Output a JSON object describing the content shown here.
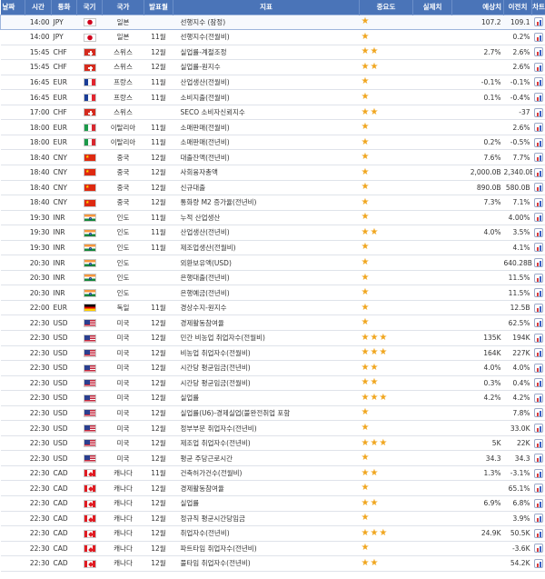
{
  "header": {
    "day": "날짜",
    "time": "시간",
    "currency": "통화",
    "flag": "국기",
    "country": "국가",
    "period": "발표월",
    "indicator": "지표",
    "importance": "중요도",
    "actual": "실제치",
    "forecast": "예상치",
    "previous": "이전치",
    "chart": "차트"
  },
  "rows": [
    {
      "time": "14:00",
      "currency": "JPY",
      "flag": "jp",
      "country": "일본",
      "period": "",
      "indicator": "선행지수 (잠정)",
      "stars": "★",
      "actual": "",
      "forecast": "107.2",
      "previous": "109.1"
    },
    {
      "time": "14:00",
      "currency": "JPY",
      "flag": "jp",
      "country": "일본",
      "period": "11월",
      "indicator": "선행지수(전월비)",
      "stars": "★",
      "actual": "",
      "forecast": "",
      "previous": "0.2%"
    },
    {
      "time": "15:45",
      "currency": "CHF",
      "flag": "ch",
      "country": "스위스",
      "period": "12월",
      "indicator": "실업률-계절조정",
      "stars": "★★",
      "actual": "",
      "forecast": "2.7%",
      "previous": "2.6%"
    },
    {
      "time": "15:45",
      "currency": "CHF",
      "flag": "ch",
      "country": "스위스",
      "period": "12월",
      "indicator": "실업률-원지수",
      "stars": "★★",
      "actual": "",
      "forecast": "",
      "previous": "2.6%"
    },
    {
      "time": "16:45",
      "currency": "EUR",
      "flag": "fr",
      "country": "프랑스",
      "period": "11월",
      "indicator": "산업생산(전월비)",
      "stars": "★",
      "actual": "",
      "forecast": "-0.1%",
      "previous": "-0.1%"
    },
    {
      "time": "16:45",
      "currency": "EUR",
      "flag": "fr",
      "country": "프랑스",
      "period": "11월",
      "indicator": "소비지출(전월비)",
      "stars": "★",
      "actual": "",
      "forecast": "0.1%",
      "previous": "-0.4%"
    },
    {
      "time": "17:00",
      "currency": "CHF",
      "flag": "ch",
      "country": "스위스",
      "period": "",
      "indicator": "SECO 소비자신뢰지수",
      "stars": "★★",
      "actual": "",
      "forecast": "",
      "previous": "-37"
    },
    {
      "time": "18:00",
      "currency": "EUR",
      "flag": "it",
      "country": "이탈리아",
      "period": "11월",
      "indicator": "소매판매(전월비)",
      "stars": "★",
      "actual": "",
      "forecast": "",
      "previous": "2.6%"
    },
    {
      "time": "18:00",
      "currency": "EUR",
      "flag": "it",
      "country": "이탈리아",
      "period": "11월",
      "indicator": "소매판매(전년비)",
      "stars": "★",
      "actual": "",
      "forecast": "0.2%",
      "previous": "-0.5%"
    },
    {
      "time": "18:40",
      "currency": "CNY",
      "flag": "cn",
      "country": "중국",
      "period": "12월",
      "indicator": "대출잔액(전년비)",
      "stars": "★",
      "actual": "",
      "forecast": "7.6%",
      "previous": "7.7%"
    },
    {
      "time": "18:40",
      "currency": "CNY",
      "flag": "cn",
      "country": "중국",
      "period": "12월",
      "indicator": "사회융자총액",
      "stars": "★",
      "actual": "",
      "forecast": "2,000.0B",
      "previous": "2,340.0B"
    },
    {
      "time": "18:40",
      "currency": "CNY",
      "flag": "cn",
      "country": "중국",
      "period": "12월",
      "indicator": "신규대출",
      "stars": "★",
      "actual": "",
      "forecast": "890.0B",
      "previous": "580.0B"
    },
    {
      "time": "18:40",
      "currency": "CNY",
      "flag": "cn",
      "country": "중국",
      "period": "12월",
      "indicator": "통화량 M2 증가율(전년비)",
      "stars": "★",
      "actual": "",
      "forecast": "7.3%",
      "previous": "7.1%"
    },
    {
      "time": "19:30",
      "currency": "INR",
      "flag": "in",
      "country": "인도",
      "period": "11월",
      "indicator": "누적 산업생산",
      "stars": "★",
      "actual": "",
      "forecast": "",
      "previous": "4.00%"
    },
    {
      "time": "19:30",
      "currency": "INR",
      "flag": "in",
      "country": "인도",
      "period": "11월",
      "indicator": "산업생산(전년비)",
      "stars": "★★",
      "actual": "",
      "forecast": "4.0%",
      "previous": "3.5%"
    },
    {
      "time": "19:30",
      "currency": "INR",
      "flag": "in",
      "country": "인도",
      "period": "11월",
      "indicator": "제조업생산(전월비)",
      "stars": "★",
      "actual": "",
      "forecast": "",
      "previous": "4.1%"
    },
    {
      "time": "20:30",
      "currency": "INR",
      "flag": "in",
      "country": "인도",
      "period": "",
      "indicator": "외환보유액(USD)",
      "stars": "★",
      "actual": "",
      "forecast": "",
      "previous": "640.28B"
    },
    {
      "time": "20:30",
      "currency": "INR",
      "flag": "in",
      "country": "인도",
      "period": "",
      "indicator": "은행대출(전년비)",
      "stars": "★",
      "actual": "",
      "forecast": "",
      "previous": "11.5%"
    },
    {
      "time": "20:30",
      "currency": "INR",
      "flag": "in",
      "country": "인도",
      "period": "",
      "indicator": "은행예금(전년비)",
      "stars": "★",
      "actual": "",
      "forecast": "",
      "previous": "11.5%"
    },
    {
      "time": "22:00",
      "currency": "EUR",
      "flag": "de",
      "country": "독일",
      "period": "11월",
      "indicator": "경상수지-원지수",
      "stars": "★",
      "actual": "",
      "forecast": "",
      "previous": "12.5B"
    },
    {
      "time": "22:30",
      "currency": "USD",
      "flag": "us",
      "country": "미국",
      "period": "12월",
      "indicator": "경제활동참여율",
      "stars": "★",
      "actual": "",
      "forecast": "",
      "previous": "62.5%"
    },
    {
      "time": "22:30",
      "currency": "USD",
      "flag": "us",
      "country": "미국",
      "period": "12월",
      "indicator": "민간 비농업 취업자수(전월비)",
      "stars": "★★★",
      "actual": "",
      "forecast": "135K",
      "previous": "194K"
    },
    {
      "time": "22:30",
      "currency": "USD",
      "flag": "us",
      "country": "미국",
      "period": "12월",
      "indicator": "비농업 취업자수(전월비)",
      "stars": "★★★",
      "actual": "",
      "forecast": "164K",
      "previous": "227K"
    },
    {
      "time": "22:30",
      "currency": "USD",
      "flag": "us",
      "country": "미국",
      "period": "12월",
      "indicator": "시간당 평균임금(전년비)",
      "stars": "★★",
      "actual": "",
      "forecast": "4.0%",
      "previous": "4.0%"
    },
    {
      "time": "22:30",
      "currency": "USD",
      "flag": "us",
      "country": "미국",
      "period": "12월",
      "indicator": "시간당 평균임금(전월비)",
      "stars": "★★",
      "actual": "",
      "forecast": "0.3%",
      "previous": "0.4%"
    },
    {
      "time": "22:30",
      "currency": "USD",
      "flag": "us",
      "country": "미국",
      "period": "12월",
      "indicator": "실업률",
      "stars": "★★★",
      "actual": "",
      "forecast": "4.2%",
      "previous": "4.2%"
    },
    {
      "time": "22:30",
      "currency": "USD",
      "flag": "us",
      "country": "미국",
      "period": "12월",
      "indicator": "실업률(U6)-경제실업(불완전취업 포함",
      "stars": "★",
      "actual": "",
      "forecast": "",
      "previous": "7.8%"
    },
    {
      "time": "22:30",
      "currency": "USD",
      "flag": "us",
      "country": "미국",
      "period": "12월",
      "indicator": "정부부문 취업자수(전년비)",
      "stars": "★",
      "actual": "",
      "forecast": "",
      "previous": "33.0K"
    },
    {
      "time": "22:30",
      "currency": "USD",
      "flag": "us",
      "country": "미국",
      "period": "12월",
      "indicator": "제조업 취업자수(전년비)",
      "stars": "★★★",
      "actual": "",
      "forecast": "5K",
      "previous": "22K"
    },
    {
      "time": "22:30",
      "currency": "USD",
      "flag": "us",
      "country": "미국",
      "period": "12월",
      "indicator": "평균 주당근로시간",
      "stars": "★",
      "actual": "",
      "forecast": "34.3",
      "previous": "34.3"
    },
    {
      "time": "22:30",
      "currency": "CAD",
      "flag": "ca",
      "country": "캐나다",
      "period": "11월",
      "indicator": "건축허가건수(전월비)",
      "stars": "★★",
      "actual": "",
      "forecast": "1.3%",
      "previous": "-3.1%"
    },
    {
      "time": "22:30",
      "currency": "CAD",
      "flag": "ca",
      "country": "캐나다",
      "period": "12월",
      "indicator": "경제활동참여율",
      "stars": "★",
      "actual": "",
      "forecast": "",
      "previous": "65.1%"
    },
    {
      "time": "22:30",
      "currency": "CAD",
      "flag": "ca",
      "country": "캐나다",
      "period": "12월",
      "indicator": "실업률",
      "stars": "★★",
      "actual": "",
      "forecast": "6.9%",
      "previous": "6.8%"
    },
    {
      "time": "22:30",
      "currency": "CAD",
      "flag": "ca",
      "country": "캐나다",
      "period": "12월",
      "indicator": "정규직 평균시간당임금",
      "stars": "★",
      "actual": "",
      "forecast": "",
      "previous": "3.9%"
    },
    {
      "time": "22:30",
      "currency": "CAD",
      "flag": "ca",
      "country": "캐나다",
      "period": "12월",
      "indicator": "취업자수(전년비)",
      "stars": "★★★",
      "actual": "",
      "forecast": "24.9K",
      "previous": "50.5K"
    },
    {
      "time": "22:30",
      "currency": "CAD",
      "flag": "ca",
      "country": "캐나다",
      "period": "12월",
      "indicator": "파트타임 취업자수(전년비)",
      "stars": "★",
      "actual": "",
      "forecast": "",
      "previous": "-3.6K"
    },
    {
      "time": "22:30",
      "currency": "CAD",
      "flag": "ca",
      "country": "캐나다",
      "period": "12월",
      "indicator": "풀타임 취업자수(전년비)",
      "stars": "★★",
      "actual": "",
      "forecast": "",
      "previous": "54.2K"
    }
  ],
  "colors": {
    "header_bg": "#4a74b8",
    "star": "#f0a61f",
    "row_border": "#dfe3ea"
  },
  "icons": {
    "chart": "chart-icon",
    "flag": "flag-icon"
  }
}
